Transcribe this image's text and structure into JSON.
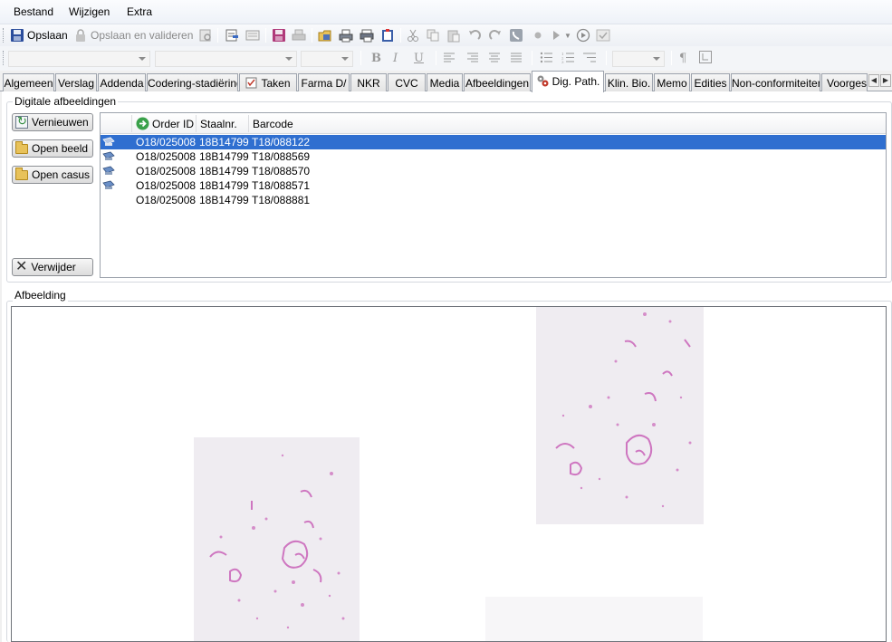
{
  "menu": {
    "items": [
      "Bestand",
      "Wijzigen",
      "Extra"
    ]
  },
  "toolbar": {
    "save_label": "Opslaan",
    "save_validate_label": "Opslaan en valideren"
  },
  "tabs": [
    {
      "label": "Algemeen"
    },
    {
      "label": "Verslag"
    },
    {
      "label": "Addenda"
    },
    {
      "label": "Codering-stadiëring"
    },
    {
      "label": "Taken"
    },
    {
      "label": "Farma D/"
    },
    {
      "label": "NKR"
    },
    {
      "label": "CVC"
    },
    {
      "label": "Media"
    },
    {
      "label": "Afbeeldingen"
    },
    {
      "label": "Dig. Path."
    },
    {
      "label": "Klin. Bio."
    },
    {
      "label": "Memo"
    },
    {
      "label": "Edities"
    },
    {
      "label": "Non-conformiteiten"
    },
    {
      "label": "Voorgesc"
    }
  ],
  "digital_images": {
    "group_label": "Digitale afbeeldingen",
    "buttons": {
      "refresh": "Vernieuwen",
      "open_image": "Open beeld",
      "open_case": "Open casus",
      "remove": "Verwijder"
    },
    "columns": [
      "Order ID",
      "Staalnr.",
      "Barcode"
    ],
    "rows": [
      {
        "order_id": "O18/025008",
        "sample": "18B14799",
        "barcode": "T18/088122",
        "selected": true
      },
      {
        "order_id": "O18/025008",
        "sample": "18B14799",
        "barcode": "T18/088569"
      },
      {
        "order_id": "O18/025008",
        "sample": "18B14799",
        "barcode": "T18/088570"
      },
      {
        "order_id": "O18/025008",
        "sample": "18B14799",
        "barcode": "T18/088571"
      },
      {
        "order_id": "O18/025008",
        "sample": "18B14799",
        "barcode": "T18/088881"
      }
    ]
  },
  "image_panel": {
    "group_label": "Afbeelding"
  },
  "colors": {
    "selection": "#2f6fd0",
    "tissue_stain": "#c44fb0"
  }
}
